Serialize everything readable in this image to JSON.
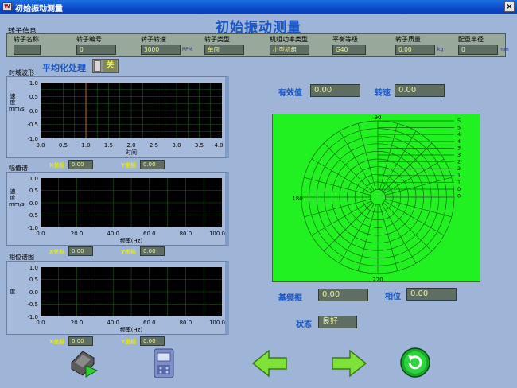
{
  "window": {
    "title": "初始振动测量"
  },
  "page_title": "初始振动测量",
  "rotor_info": {
    "label": "转子信息",
    "fields": [
      {
        "label": "转子名称",
        "value": "",
        "unit": ""
      },
      {
        "label": "转子编号",
        "value": "0",
        "unit": ""
      },
      {
        "label": "转子转速",
        "value": "3000",
        "unit": "RPM"
      },
      {
        "label": "转子类型",
        "value": "单面",
        "unit": ""
      },
      {
        "label": "机组功率类型",
        "value": "小型机组",
        "unit": ""
      },
      {
        "label": "平衡等级",
        "value": "G40",
        "unit": ""
      },
      {
        "label": "转子质量",
        "value": "0.00",
        "unit": "kg"
      },
      {
        "label": "配重半径",
        "value": "0",
        "unit": "mm"
      }
    ]
  },
  "averaging": {
    "label": "平均化处理",
    "state": "关"
  },
  "time_wave": {
    "label": "时域波形",
    "ylabel": "速度mm/s",
    "xlabel": "时间",
    "y_ticks": [
      "1.0",
      "0.5",
      "0.0",
      "-0.5",
      "-1.0"
    ],
    "x_ticks": [
      "0.0",
      "0.5",
      "1.0",
      "1.5",
      "2.0",
      "2.5",
      "3.0",
      "3.5",
      "4.0"
    ],
    "x_coord_label": "X坐标",
    "x_coord": "0.00",
    "y_coord_label": "Y坐标",
    "y_coord": "0.00"
  },
  "amplitude": {
    "label": "幅值谱",
    "ylabel": "速度mm/s",
    "xlabel": "频率(Hz)",
    "y_ticks": [
      "1.0",
      "0.5",
      "0.0",
      "-0.5",
      "-1.0"
    ],
    "x_ticks": [
      "0.0",
      "20.0",
      "40.0",
      "60.0",
      "80.0",
      "100.0"
    ],
    "x_coord_label": "X坐标",
    "x_coord": "0.00",
    "y_coord_label": "Y坐标",
    "y_coord": "0.00"
  },
  "phase": {
    "label": "相位谱图",
    "ylabel": "度",
    "xlabel": "频率(Hz)",
    "y_ticks": [
      "1.0",
      "0.5",
      "0.0",
      "-0.5",
      "-1.0"
    ],
    "x_ticks": [
      "0.0",
      "20.0",
      "40.0",
      "60.0",
      "80.0",
      "100.0"
    ],
    "x_coord_label": "X坐标",
    "x_coord": "0.00",
    "y_coord_label": "Y坐标",
    "y_coord": "0.00"
  },
  "effective": {
    "label": "有效值",
    "value": "0.00"
  },
  "speed": {
    "label": "转速",
    "value": "0.00"
  },
  "polar": {
    "angle_labels": [
      "90",
      "180",
      "270"
    ],
    "right_scale": [
      "5",
      "5",
      "4",
      "4",
      "3",
      "3",
      "2",
      "2",
      "1",
      "1",
      "0",
      "0"
    ]
  },
  "fundamental": {
    "label": "基频振",
    "value": "0.00"
  },
  "phase_readout": {
    "label": "相位",
    "value": "0.00"
  },
  "status": {
    "label": "状态",
    "value": "良好"
  },
  "buttons": [
    "run-icon",
    "device-icon",
    "back-arrow-icon",
    "forward-arrow-icon",
    "refresh-icon"
  ]
}
